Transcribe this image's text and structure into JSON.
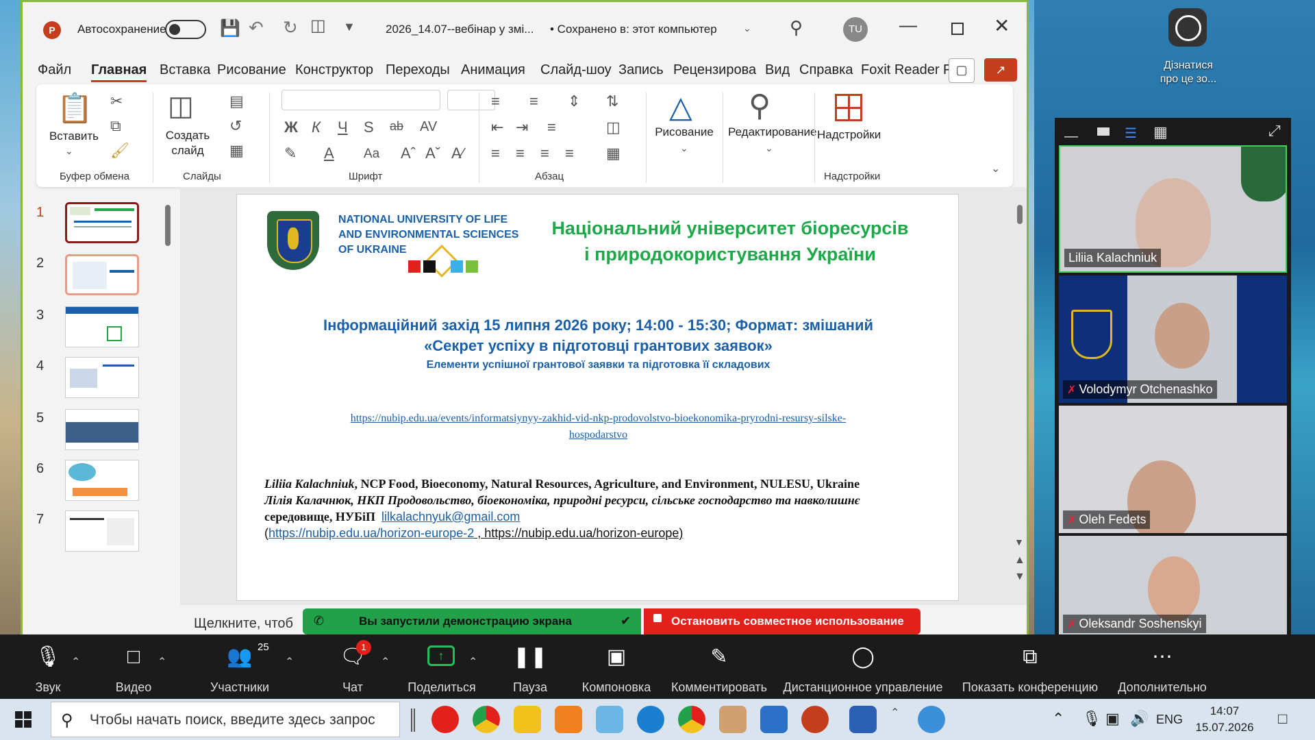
{
  "ppt": {
    "autosave_label": "Автосохранение",
    "filename": "2026_14.07--вебінар у змі...",
    "saved_status": "• Сохранено в: этот компьютер",
    "user_initials": "TU",
    "menu": [
      "Файл",
      "Главная",
      "Вставка",
      "Рисование",
      "Конструктор",
      "Переходы",
      "Анимация",
      "Слайд-шоу",
      "Запись",
      "Рецензирова",
      "Вид",
      "Справка",
      "Foxit Reader F"
    ],
    "ribbon": {
      "paste": "Вставить",
      "clipboard": "Буфер обмена",
      "new_slide": "Создать слайд",
      "slides": "Слайды",
      "font": "Шрифт",
      "paragraph": "Абзац",
      "drawing": "Рисование",
      "editing": "Редактирование",
      "addins": "Надстройки",
      "addins_group": "Надстройки"
    },
    "slide_numbers": [
      "1",
      "2",
      "3",
      "4",
      "5",
      "6",
      "7"
    ],
    "notes_placeholder": "Щелкните, чтоб"
  },
  "slide": {
    "uni_en": "NATIONAL UNIVERSITY OF LIFE AND ENVIRONMENTAL SCIENCES OF UKRAINE",
    "uni_en_1": "NATIONAL UNIVERSITY OF LIFE",
    "uni_en_2": "AND ENVIRONMENTAL SCIENCES",
    "uni_en_3": "OF UKRAINE",
    "uni_ua_1": "Національний університет біоресурсів",
    "uni_ua_2": "і природокористування України",
    "event": "Інформаційний захід 15 липня 2026 року; 14:00 - 15:30; Формат: змішаний",
    "event_title": "«Секрет успіху в підготовці грантових заявок»",
    "event_sub": "Елементи успішної грантової заявки та підготовка її складових",
    "url_1": "https://nubip.edu.ua/events/informatsiynyy-zakhid-vid-nkp-prodovolstvo-bioekonomika-pryrodni-resursy-silske-",
    "url_2": "hospodarstvo",
    "speaker_en_name": "Liliia Kalachniuk",
    "speaker_en_rest": ", NCP Food, Bioeconomy, Natural Resources, Agriculture, and Environment, NULESU, Ukraine",
    "speaker_ua_name": "Лілія Калачнюк",
    "speaker_ua_rest": ", НКП Продовольство, біоекономіка, природні ресурси, сільське господарство та навколишнє",
    "speaker_ua_line2": "середовище, НУБіП",
    "email": "lilkalachnyuk@gmail.com",
    "links_open": "(",
    "link_1": "https://nubip.edu.ua/horizon-europe-2",
    "link_2": " , https://nubip.edu.ua/horizon-europe)"
  },
  "desktop": {
    "learn_more_1": "Дізнатися",
    "learn_more_2": "про це зо..."
  },
  "participants": [
    {
      "name": "Liliia Kalachniuk",
      "muted": false
    },
    {
      "name": "Volodymyr Otchenashko",
      "muted": true
    },
    {
      "name": "Oleh Fedets",
      "muted": true
    },
    {
      "name": "Oleksandr Soshenskyi",
      "muted": true
    }
  ],
  "share_banner": {
    "started": "Вы запустили демонстрацию экрана",
    "stop": "Остановить совместное использование"
  },
  "zoombar": {
    "audio": "Звук",
    "video": "Видео",
    "participants": "Участники",
    "participants_count": "25",
    "chat": "Чат",
    "chat_badge": "1",
    "share": "Поделиться",
    "pause": "Пауза",
    "layout": "Компоновка",
    "annotate": "Комментировать",
    "remote": "Дистанционное управление",
    "show_conf": "Показать конференцию",
    "more": "Дополнительно"
  },
  "taskbar": {
    "search_placeholder": "Чтобы начать поиск, введите здесь запрос",
    "lang": "ENG",
    "time": "14:07",
    "date": "15.07.2026"
  },
  "colors": {
    "ppt_accent": "#c43e1c",
    "slide_green": "#1fa84a",
    "slide_blue": "#1a5fa8",
    "zoom_green": "#22a04a",
    "zoom_red": "#e2201c"
  }
}
